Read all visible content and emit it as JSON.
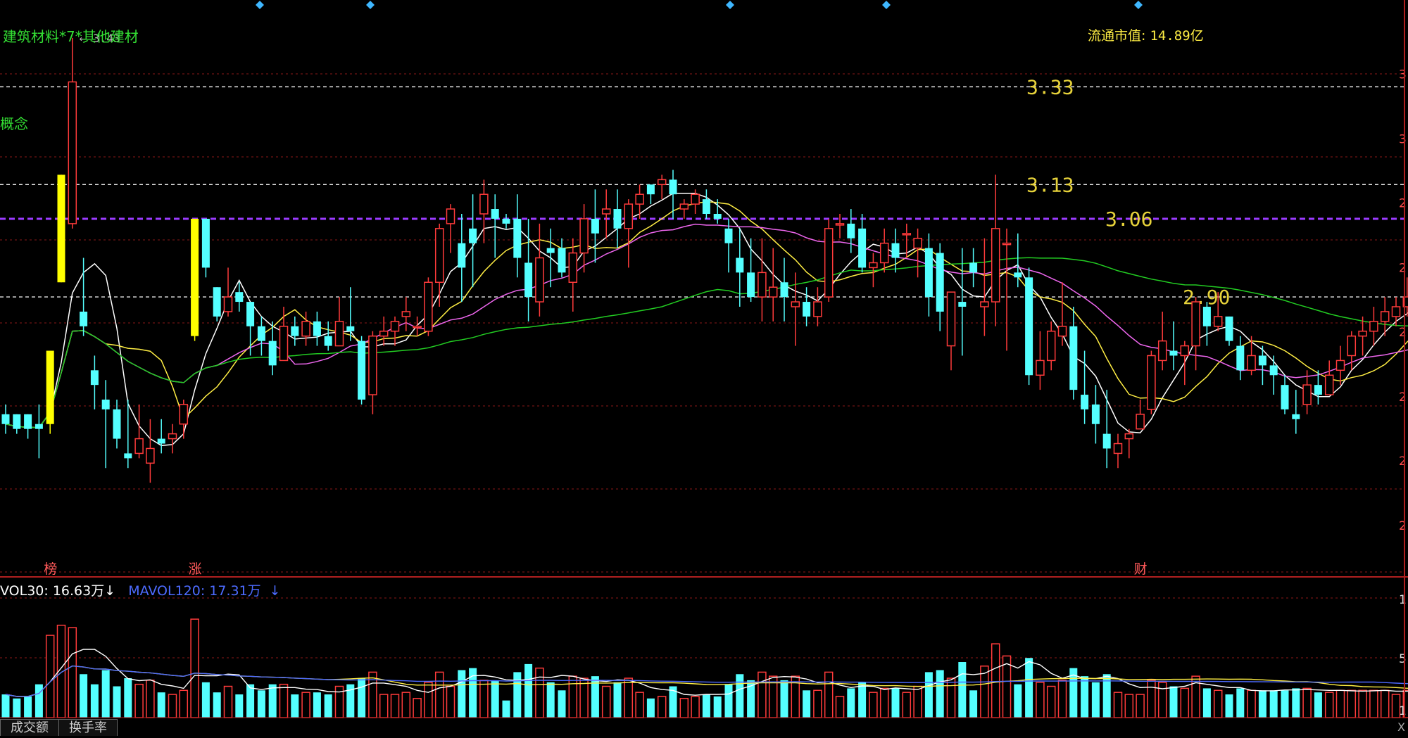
{
  "header": {
    "industry": "建筑材料*7*其他建材",
    "concept": "概念",
    "market_cap_label": "流通市值:",
    "market_cap_value": "14.89亿",
    "peak_label": "3.43"
  },
  "price_levels": [
    {
      "label": "3.33",
      "value": 3.33,
      "style": "white-dashed"
    },
    {
      "label": "3.13",
      "value": 3.13,
      "style": "white-dashed"
    },
    {
      "label": "3.06",
      "value": 3.06,
      "style": "purple-dashed"
    },
    {
      "label": "2.90",
      "value": 2.9,
      "style": "white-dashed"
    }
  ],
  "markers": [
    {
      "text": "榜",
      "index": 4
    },
    {
      "text": "涨",
      "index": 17
    },
    {
      "text": "财",
      "index": 102
    }
  ],
  "volume_legend": {
    "mavol30": "VOL30: 16.63万",
    "mavol30_arrow": "↓",
    "mavol120": "MAVOL120: 17.31万",
    "mavol120_arrow": "↓"
  },
  "right_axis_partial": {
    "price": [
      "3",
      "3",
      "2",
      "2",
      "2",
      "2",
      "2",
      "2"
    ],
    "volume": [
      "1",
      "5",
      "1"
    ]
  },
  "tabs": [
    {
      "label": "成交额"
    },
    {
      "label": "换手率"
    }
  ],
  "right_corner": "X",
  "colors": {
    "up": "#ff3b3b",
    "down": "#54ffff",
    "limit_up": "#ffff00",
    "ma5": "#ffffff",
    "ma10": "#ffee44",
    "ma20": "#ee66ee",
    "ma60": "#22cc22",
    "mavol120": "#4d6bff",
    "grid": "#8a1818"
  },
  "chart_data": {
    "type": "candlestick",
    "ylim": [
      2.5,
      3.45
    ],
    "grid": true,
    "candles": [
      [
        2.66,
        2.68,
        2.62,
        2.64
      ],
      [
        2.66,
        2.66,
        2.62,
        2.63
      ],
      [
        2.66,
        2.66,
        2.61,
        2.63
      ],
      [
        2.64,
        2.68,
        2.57,
        2.63
      ],
      [
        2.64,
        2.79,
        2.62,
        2.79
      ],
      [
        2.93,
        3.15,
        2.93,
        3.15
      ],
      [
        3.05,
        3.43,
        3.04,
        3.34
      ],
      [
        2.87,
        2.98,
        2.82,
        2.84
      ],
      [
        2.75,
        2.78,
        2.67,
        2.72
      ],
      [
        2.69,
        2.73,
        2.55,
        2.67
      ],
      [
        2.67,
        2.69,
        2.59,
        2.61
      ],
      [
        2.58,
        2.69,
        2.55,
        2.57
      ],
      [
        2.58,
        2.68,
        2.57,
        2.61
      ],
      [
        2.56,
        2.65,
        2.52,
        2.59
      ],
      [
        2.61,
        2.65,
        2.58,
        2.6
      ],
      [
        2.61,
        2.64,
        2.58,
        2.62
      ],
      [
        2.64,
        2.69,
        2.61,
        2.68
      ],
      [
        2.82,
        3.06,
        2.81,
        3.06
      ],
      [
        3.06,
        3.06,
        2.94,
        2.96
      ],
      [
        2.92,
        2.92,
        2.85,
        2.86
      ],
      [
        2.87,
        2.96,
        2.86,
        2.9
      ],
      [
        2.91,
        2.93,
        2.87,
        2.89
      ],
      [
        2.89,
        2.89,
        2.78,
        2.84
      ],
      [
        2.84,
        2.86,
        2.78,
        2.81
      ],
      [
        2.81,
        2.85,
        2.74,
        2.76
      ],
      [
        2.77,
        2.88,
        2.77,
        2.84
      ],
      [
        2.84,
        2.86,
        2.8,
        2.82
      ],
      [
        2.82,
        2.87,
        2.8,
        2.85
      ],
      [
        2.85,
        2.87,
        2.8,
        2.82
      ],
      [
        2.82,
        2.85,
        2.79,
        2.8
      ],
      [
        2.8,
        2.9,
        2.8,
        2.85
      ],
      [
        2.84,
        2.92,
        2.81,
        2.83
      ],
      [
        2.81,
        2.82,
        2.68,
        2.69
      ],
      [
        2.7,
        2.83,
        2.66,
        2.82
      ],
      [
        2.82,
        2.86,
        2.8,
        2.83
      ],
      [
        2.83,
        2.86,
        2.8,
        2.85
      ],
      [
        2.86,
        2.9,
        2.83,
        2.87
      ],
      [
        2.84,
        2.86,
        2.82,
        2.84
      ],
      [
        2.83,
        2.94,
        2.82,
        2.93
      ],
      [
        2.93,
        3.05,
        2.88,
        3.04
      ],
      [
        3.05,
        3.09,
        2.99,
        3.08
      ],
      [
        3.01,
        3.07,
        2.89,
        2.96
      ],
      [
        3.04,
        3.11,
        2.92,
        3.01
      ],
      [
        3.07,
        3.14,
        3.01,
        3.11
      ],
      [
        3.08,
        3.11,
        2.98,
        3.06
      ],
      [
        3.06,
        3.07,
        3.04,
        3.05
      ],
      [
        3.06,
        3.11,
        2.94,
        2.98
      ],
      [
        2.97,
        3.06,
        2.85,
        2.9
      ],
      [
        2.89,
        3.05,
        2.86,
        2.98
      ],
      [
        3.0,
        3.04,
        2.92,
        2.99
      ],
      [
        3.0,
        3.02,
        2.94,
        2.95
      ],
      [
        2.93,
        3.02,
        2.87,
        2.99
      ],
      [
        2.99,
        3.09,
        2.95,
        3.06
      ],
      [
        3.06,
        3.12,
        2.97,
        3.03
      ],
      [
        3.07,
        3.12,
        3.02,
        3.08
      ],
      [
        3.08,
        3.12,
        3.0,
        3.04
      ],
      [
        3.04,
        3.1,
        2.96,
        3.09
      ],
      [
        3.09,
        3.13,
        3.06,
        3.11
      ],
      [
        3.13,
        3.13,
        3.09,
        3.11
      ],
      [
        3.13,
        3.15,
        3.1,
        3.14
      ],
      [
        3.14,
        3.16,
        3.06,
        3.11
      ],
      [
        3.08,
        3.1,
        3.06,
        3.09
      ],
      [
        3.09,
        3.12,
        3.07,
        3.11
      ],
      [
        3.1,
        3.12,
        3.06,
        3.07
      ],
      [
        3.07,
        3.1,
        3.05,
        3.06
      ],
      [
        3.04,
        3.06,
        2.95,
        3.01
      ],
      [
        2.98,
        3.04,
        2.88,
        2.95
      ],
      [
        2.95,
        3.02,
        2.89,
        2.9
      ],
      [
        2.9,
        3.02,
        2.85,
        2.95
      ],
      [
        2.9,
        3.0,
        2.85,
        2.92
      ],
      [
        2.93,
        2.98,
        2.85,
        2.9
      ],
      [
        2.88,
        2.95,
        2.8,
        2.89
      ],
      [
        2.89,
        2.92,
        2.84,
        2.86
      ],
      [
        2.86,
        2.92,
        2.84,
        2.89
      ],
      [
        2.9,
        3.06,
        2.89,
        3.04
      ],
      [
        3.05,
        3.07,
        3.02,
        3.05
      ],
      [
        3.05,
        3.08,
        2.99,
        3.02
      ],
      [
        3.04,
        3.07,
        2.95,
        2.96
      ],
      [
        2.96,
        2.99,
        2.92,
        2.97
      ],
      [
        2.97,
        3.04,
        2.95,
        3.01
      ],
      [
        3.01,
        3.04,
        2.95,
        2.98
      ],
      [
        3.03,
        3.05,
        2.98,
        3.03
      ],
      [
        3.0,
        3.04,
        2.94,
        3.02
      ],
      [
        3.0,
        3.03,
        2.86,
        2.9
      ],
      [
        2.99,
        3.01,
        2.83,
        2.87
      ],
      [
        2.8,
        2.89,
        2.75,
        2.91
      ],
      [
        2.89,
        3.0,
        2.78,
        2.88
      ],
      [
        2.97,
        3.0,
        2.92,
        2.95
      ],
      [
        2.88,
        3.02,
        2.82,
        2.89
      ],
      [
        2.89,
        3.15,
        2.84,
        3.04
      ],
      [
        3.01,
        3.04,
        2.79,
        3.01
      ],
      [
        2.95,
        3.03,
        2.92,
        2.94
      ],
      [
        2.94,
        2.96,
        2.72,
        2.74
      ],
      [
        2.74,
        2.83,
        2.71,
        2.77
      ],
      [
        2.77,
        2.85,
        2.75,
        2.83
      ],
      [
        2.82,
        2.93,
        2.8,
        2.84
      ],
      [
        2.84,
        2.88,
        2.69,
        2.71
      ],
      [
        2.7,
        2.79,
        2.64,
        2.67
      ],
      [
        2.68,
        2.72,
        2.6,
        2.64
      ],
      [
        2.62,
        2.71,
        2.55,
        2.59
      ],
      [
        2.58,
        2.62,
        2.55,
        2.6
      ],
      [
        2.61,
        2.63,
        2.57,
        2.62
      ],
      [
        2.63,
        2.69,
        2.63,
        2.66
      ],
      [
        2.67,
        2.79,
        2.66,
        2.78
      ],
      [
        2.77,
        2.87,
        2.75,
        2.81
      ],
      [
        2.79,
        2.85,
        2.75,
        2.78
      ],
      [
        2.78,
        2.81,
        2.72,
        2.8
      ],
      [
        2.8,
        2.9,
        2.75,
        2.89
      ],
      [
        2.88,
        2.89,
        2.8,
        2.84
      ],
      [
        2.84,
        2.91,
        2.83,
        2.86
      ],
      [
        2.86,
        2.86,
        2.8,
        2.81
      ],
      [
        2.8,
        2.82,
        2.73,
        2.75
      ],
      [
        2.75,
        2.82,
        2.74,
        2.78
      ],
      [
        2.78,
        2.8,
        2.72,
        2.76
      ],
      [
        2.76,
        2.78,
        2.7,
        2.74
      ],
      [
        2.72,
        2.74,
        2.66,
        2.67
      ],
      [
        2.66,
        2.71,
        2.62,
        2.65
      ],
      [
        2.68,
        2.75,
        2.66,
        2.72
      ],
      [
        2.72,
        2.75,
        2.68,
        2.7
      ],
      [
        2.7,
        2.77,
        2.7,
        2.74
      ],
      [
        2.75,
        2.8,
        2.72,
        2.77
      ],
      [
        2.78,
        2.83,
        2.75,
        2.82
      ],
      [
        2.82,
        2.86,
        2.78,
        2.83
      ],
      [
        2.83,
        2.88,
        2.8,
        2.85
      ],
      [
        2.85,
        2.9,
        2.82,
        2.87
      ],
      [
        2.86,
        2.9,
        2.84,
        2.88
      ],
      [
        2.88,
        2.94,
        2.86,
        2.9
      ],
      [
        2.9,
        2.95,
        2.88,
        2.92
      ],
      [
        2.92,
        2.96,
        2.89,
        2.93
      ],
      [
        2.9,
        2.98,
        2.88,
        2.95
      ],
      [
        2.95,
        3.04,
        2.92,
        3.0
      ],
      [
        3.0,
        3.14,
        2.94,
        3.07
      ],
      [
        3.12,
        3.35,
        3.1,
        3.33
      ],
      [
        3.33,
        3.33,
        3.24,
        3.27
      ],
      [
        3.06,
        3.16,
        2.96,
        3.16
      ],
      [
        3.07,
        3.09,
        3.02,
        3.02
      ],
      [
        3.07,
        3.28,
        3.01,
        3.09
      ],
      [
        3.1,
        3.14,
        3.04,
        3.14
      ],
      [
        3.14,
        3.15,
        3.05,
        3.05
      ],
      [
        3.03,
        3.05,
        2.91,
        2.91
      ]
    ],
    "limit_up_indices": [
      4,
      5,
      17
    ],
    "ma_series": [
      {
        "name": "MA5",
        "color_key": "ma5"
      },
      {
        "name": "MA10",
        "color_key": "ma10"
      },
      {
        "name": "MA20",
        "color_key": "ma20"
      },
      {
        "name": "MA60",
        "color_key": "ma60"
      }
    ],
    "volume": {
      "ylim": [
        0,
        130
      ],
      "series": [
        {
          "name": "VOL30",
          "color_key": "ma10"
        },
        {
          "name": "MAVOL120",
          "color_key": "mavol120"
        }
      ]
    }
  }
}
